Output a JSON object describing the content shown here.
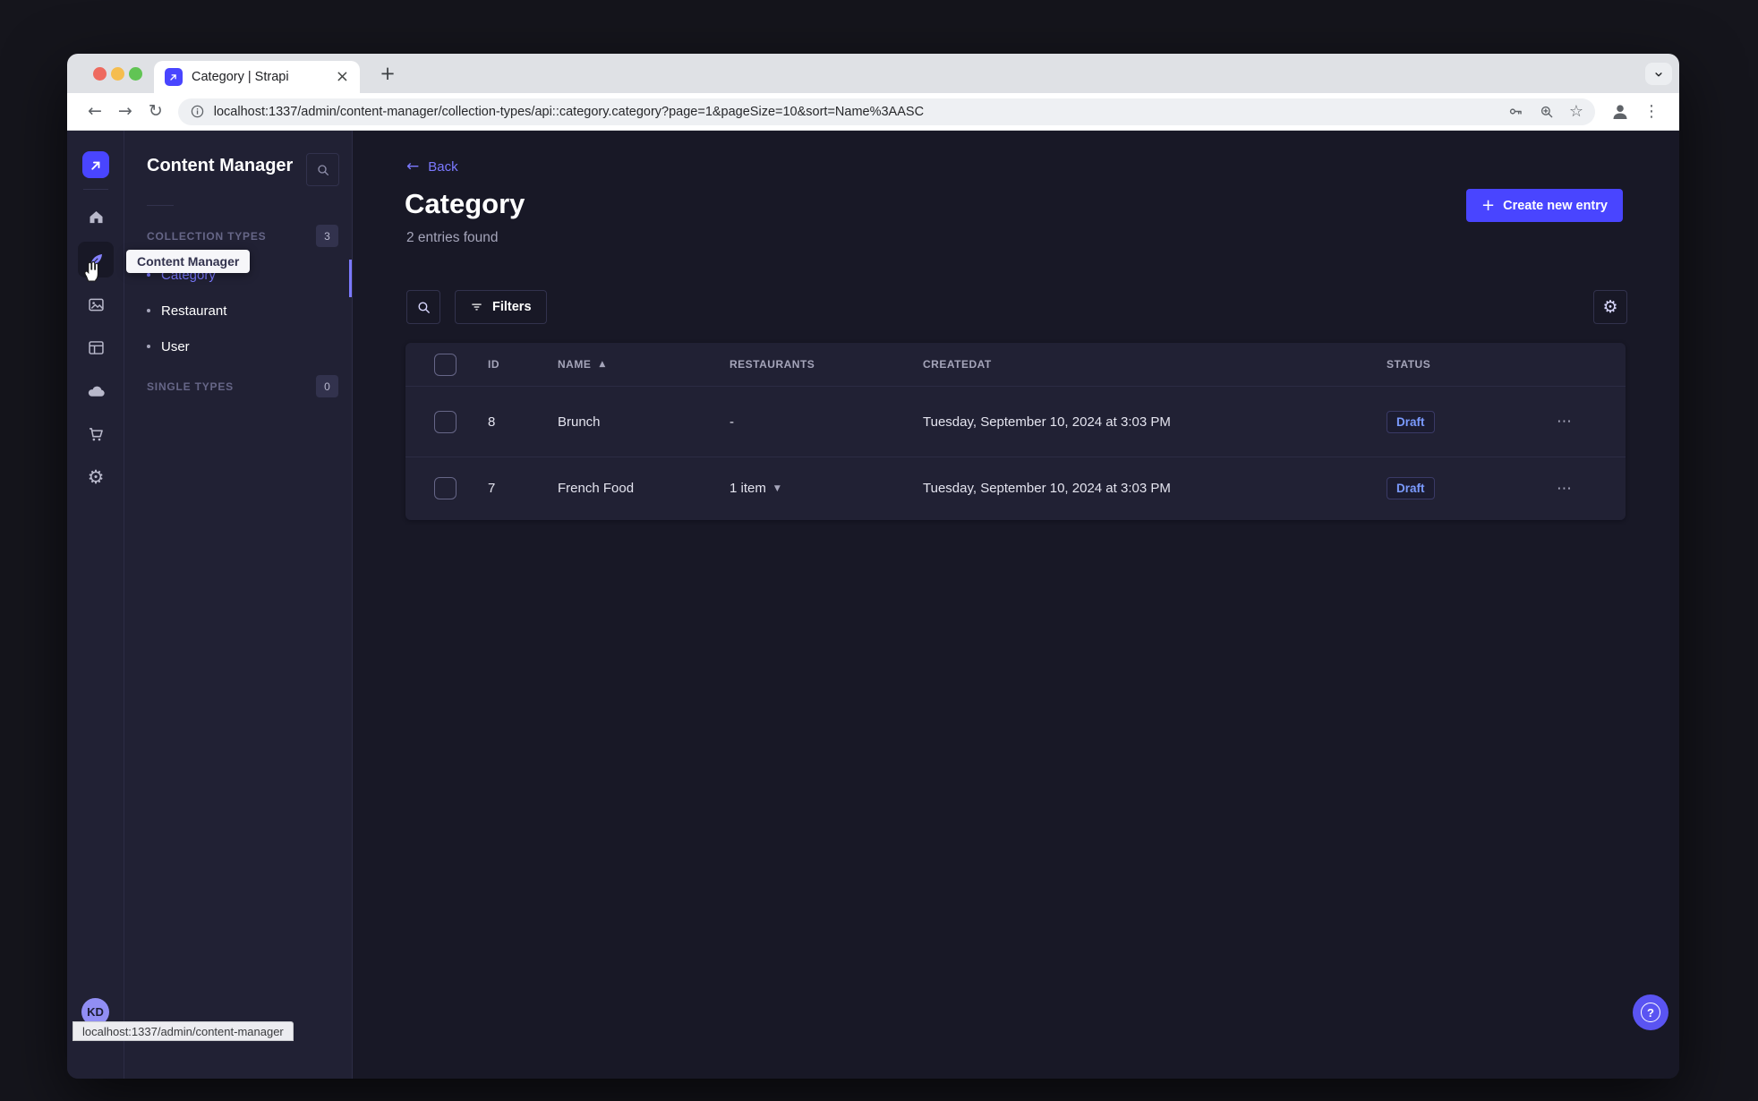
{
  "browser": {
    "tab_title": "Category | Strapi",
    "url": "localhost:1337/admin/content-manager/collection-types/api::category.category?page=1&pageSize=10&sort=Name%3AASC",
    "status_tooltip": "localhost:1337/admin/content-manager"
  },
  "nav_rail": {
    "tooltip": "Content Manager",
    "avatar_initials": "KD",
    "items": [
      "home",
      "content-manager",
      "media-library",
      "content-type-builder",
      "cloud",
      "marketplace",
      "settings"
    ]
  },
  "subnav": {
    "title": "Content Manager",
    "collection_types": {
      "label": "COLLECTION TYPES",
      "count": "3",
      "items": [
        {
          "label": "Category",
          "active": true
        },
        {
          "label": "Restaurant",
          "active": false
        },
        {
          "label": "User",
          "active": false
        }
      ]
    },
    "single_types": {
      "label": "SINGLE TYPES",
      "count": "0"
    }
  },
  "content": {
    "back_label": "Back",
    "page_title": "Category",
    "entries_count": "2 entries found",
    "create_button_label": "Create new entry",
    "filters_button_label": "Filters",
    "table": {
      "headers": {
        "id": "ID",
        "name": "NAME",
        "restaurants": "RESTAURANTS",
        "createdat": "CREATEDAT",
        "status": "STATUS"
      },
      "rows": [
        {
          "id": "8",
          "name": "Brunch",
          "restaurants": "-",
          "createdat": "Tuesday, September 10, 2024 at 3:03 PM",
          "status": "Draft"
        },
        {
          "id": "7",
          "name": "French Food",
          "restaurants": "1 item",
          "createdat": "Tuesday, September 10, 2024 at 3:03 PM",
          "status": "Draft"
        }
      ]
    }
  },
  "icons": {
    "plus": "+",
    "close": "×",
    "back_arrow": "←",
    "forward_arrow": "→",
    "reload": "↻",
    "overflow_vertical": "⋮",
    "overflow_horizontal": "⋯",
    "sort_asc": "▲",
    "caret_down": "▼",
    "star": "☆",
    "gear": "⚙",
    "help": "?"
  },
  "colors": {
    "primary": "#4945ff",
    "primary_light": "#7b79ff",
    "page_bg": "#181826",
    "surface": "#212134",
    "border": "#32324d",
    "text_muted": "#a5a5ba",
    "section_label": "#666687",
    "draft_text": "#7b9bff",
    "traffic_red": "#ee6a5f",
    "traffic_yellow": "#f5bd4f",
    "traffic_green": "#61c454"
  }
}
